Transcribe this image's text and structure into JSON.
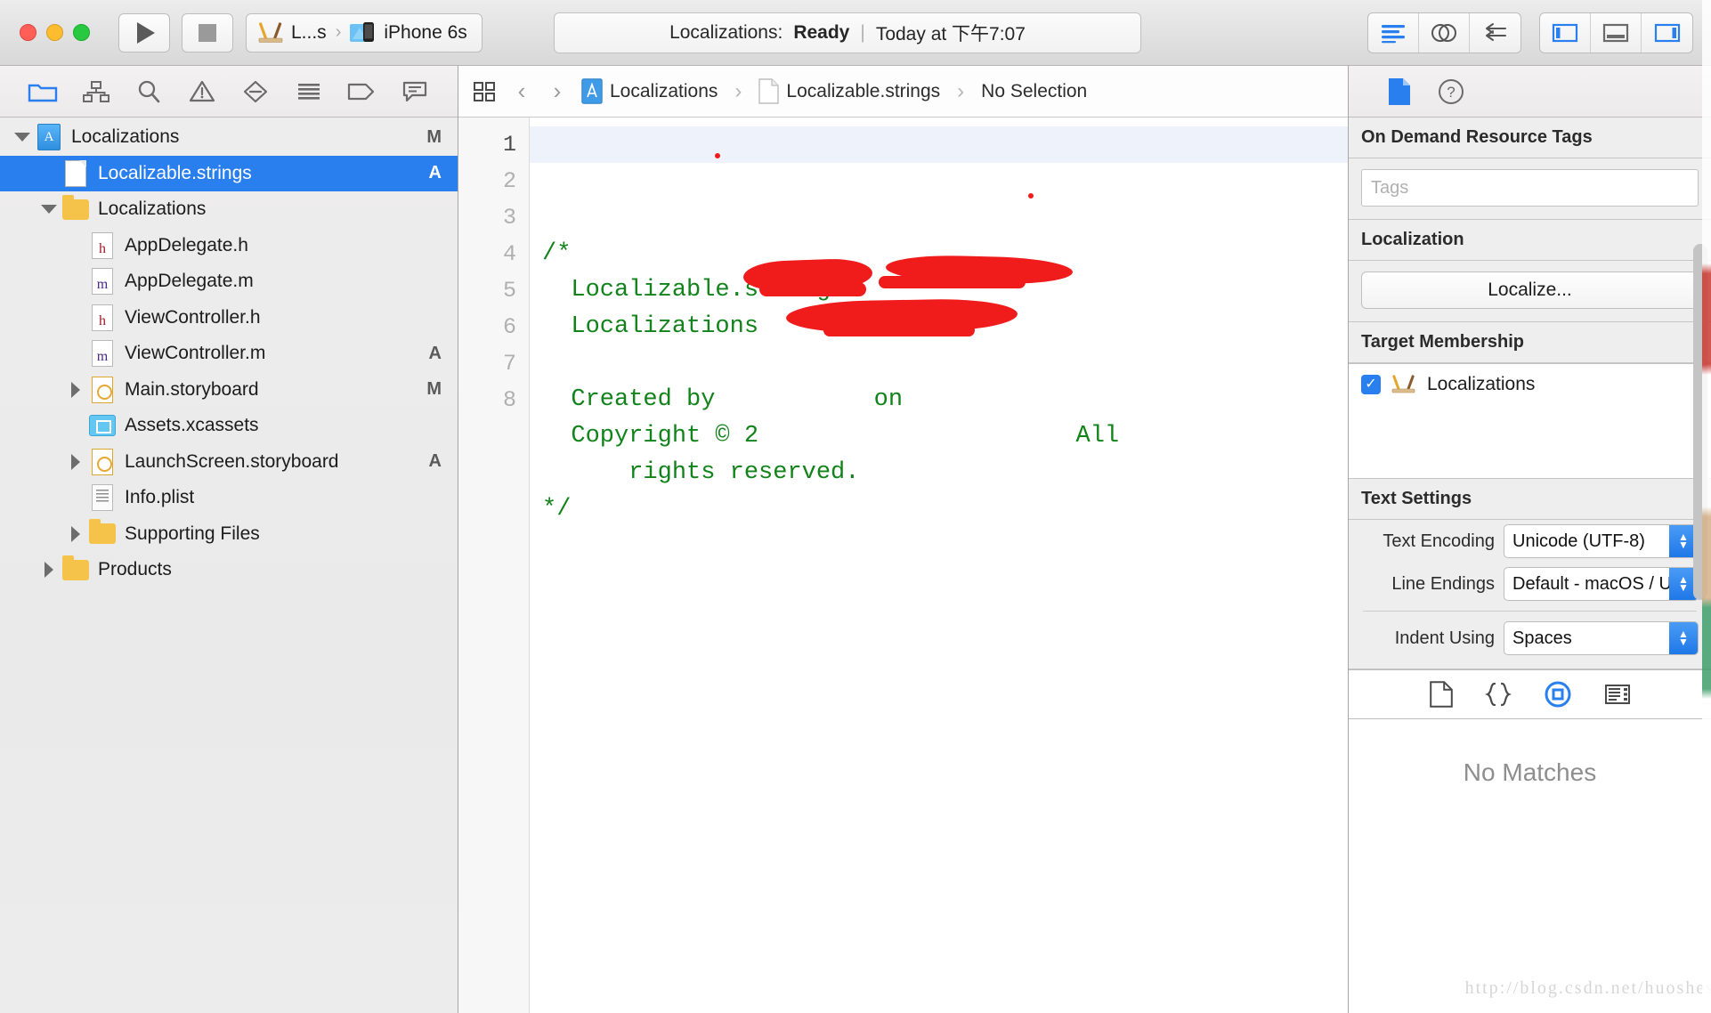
{
  "window": {
    "traffic_lights": [
      "close",
      "minimize",
      "zoom"
    ]
  },
  "toolbar": {
    "run_label": "Run",
    "stop_label": "Stop",
    "scheme_name": "L...s",
    "destination_name": "iPhone 6s",
    "status": {
      "project": "Localizations:",
      "state": "Ready",
      "divider": "|",
      "time": "Today at 下午7:07"
    },
    "editor_modes": [
      "standard-editor",
      "assistant-editor",
      "version-editor"
    ],
    "view_toggles": [
      "navigator-toggle",
      "debug-toggle",
      "utilities-toggle"
    ]
  },
  "navigator": {
    "tabs": [
      "project-navigator",
      "source-control-navigator",
      "find-navigator",
      "issue-navigator",
      "test-navigator",
      "debug-navigator",
      "breakpoint-navigator",
      "report-navigator"
    ],
    "selected_tab": "project-navigator",
    "tree": [
      {
        "label": "Localizations",
        "icon": "xcodeproj",
        "indent": 0,
        "twisty": "down",
        "badge": "M",
        "selected": false
      },
      {
        "label": "Localizable.strings",
        "icon": "doc",
        "indent": 1,
        "twisty": "none",
        "badge": "A",
        "selected": true
      },
      {
        "label": "Localizations",
        "icon": "folder",
        "indent": 1,
        "twisty": "down",
        "badge": "",
        "selected": false
      },
      {
        "label": "AppDelegate.h",
        "icon": "src-h",
        "indent": 2,
        "twisty": "none",
        "badge": "",
        "selected": false
      },
      {
        "label": "AppDelegate.m",
        "icon": "src-m",
        "indent": 2,
        "twisty": "none",
        "badge": "",
        "selected": false
      },
      {
        "label": "ViewController.h",
        "icon": "src-h",
        "indent": 2,
        "twisty": "none",
        "badge": "",
        "selected": false
      },
      {
        "label": "ViewController.m",
        "icon": "src-m",
        "indent": 2,
        "twisty": "none",
        "badge": "A",
        "selected": false
      },
      {
        "label": "Main.storyboard",
        "icon": "storyboard",
        "indent": 2,
        "twisty": "right",
        "badge": "M",
        "selected": false
      },
      {
        "label": "Assets.xcassets",
        "icon": "assets",
        "indent": 2,
        "twisty": "none",
        "badge": "",
        "selected": false
      },
      {
        "label": "LaunchScreen.storyboard",
        "icon": "storyboard",
        "indent": 2,
        "twisty": "right",
        "badge": "A",
        "selected": false
      },
      {
        "label": "Info.plist",
        "icon": "plist",
        "indent": 2,
        "twisty": "none",
        "badge": "",
        "selected": false
      },
      {
        "label": "Supporting Files",
        "icon": "folder",
        "indent": 2,
        "twisty": "right",
        "badge": "",
        "selected": false
      },
      {
        "label": "Products",
        "icon": "folder",
        "indent": 1,
        "twisty": "right",
        "badge": "",
        "selected": false
      }
    ]
  },
  "editor": {
    "jumpbar": {
      "related_items_icon": "grid-icon",
      "back_label": "‹",
      "forward_label": "›",
      "crumbs": [
        {
          "label": "Localizations",
          "icon": "xcodeproj"
        },
        {
          "label": "Localizable.strings",
          "icon": "doc"
        },
        {
          "label": "No Selection",
          "icon": "none"
        }
      ],
      "separator": "›"
    },
    "line_numbers": [
      "1",
      "2",
      "3",
      "4",
      "5",
      "6",
      "7",
      "8"
    ],
    "current_line": 1,
    "code_lines": [
      "/*",
      "  Localizable.strings",
      "  Localizations",
      "",
      "  Created by           on                ",
      "  Copyright © 2                      All",
      "      rights reserved.",
      "*/",
      ""
    ],
    "code_color": "#11831a"
  },
  "inspector": {
    "tabs": [
      "file-inspector",
      "quick-help-inspector"
    ],
    "selected_tab": "file-inspector",
    "on_demand": {
      "title": "On Demand Resource Tags",
      "tags_placeholder": "Tags",
      "tags_value": ""
    },
    "localization": {
      "title": "Localization",
      "button_label": "Localize..."
    },
    "target_membership": {
      "title": "Target Membership",
      "targets": [
        {
          "label": "Localizations",
          "checked": true
        }
      ]
    },
    "text_settings": {
      "title": "Text Settings",
      "fields": [
        {
          "label": "Text Encoding",
          "value": "Unicode (UTF-8)"
        },
        {
          "label": "Line Endings",
          "value": "Default - macOS / Unix..."
        },
        {
          "label": "Indent Using",
          "value": "Spaces"
        }
      ]
    },
    "library": {
      "tabs": [
        "file-template-library",
        "code-snippet-library",
        "object-library",
        "media-library"
      ],
      "selected_tab": "object-library",
      "empty_message": "No Matches"
    },
    "watermark": "http://blog.csdn.net/huoshes"
  },
  "colors": {
    "accent": "#2a7fef",
    "selection": "#2a7fef",
    "comment_green": "#11831a",
    "redaction_red": "#f01c1c",
    "chrome": "#ececec"
  }
}
